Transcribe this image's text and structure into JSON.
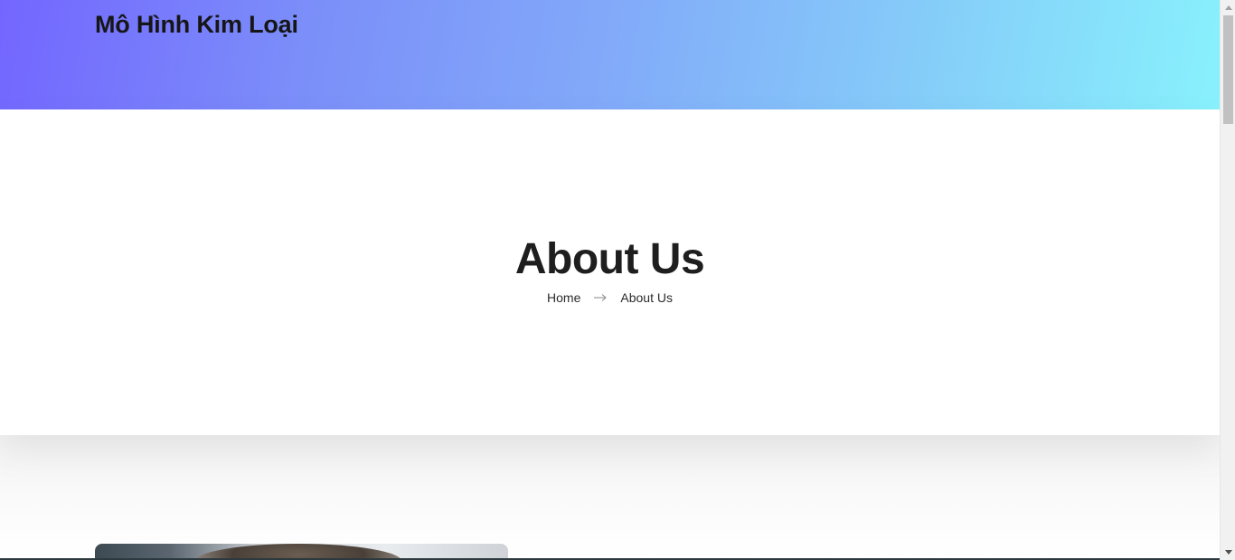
{
  "header": {
    "site_title": "Mô Hình Kim Loại"
  },
  "banner": {
    "title": "About Us",
    "breadcrumb": {
      "home": "Home",
      "separator_icon": "arrow-right-icon",
      "current": "About Us"
    }
  },
  "about_section": {
    "image_icon": "portrait-photo"
  },
  "scrollbar": {
    "up_icon": "scroll-up-arrow-icon",
    "down_icon": "scroll-down-arrow-icon"
  },
  "colors": {
    "gradient_start": "#7366ff",
    "gradient_end": "#88f1fc",
    "title_text": "#1e1e1e"
  }
}
